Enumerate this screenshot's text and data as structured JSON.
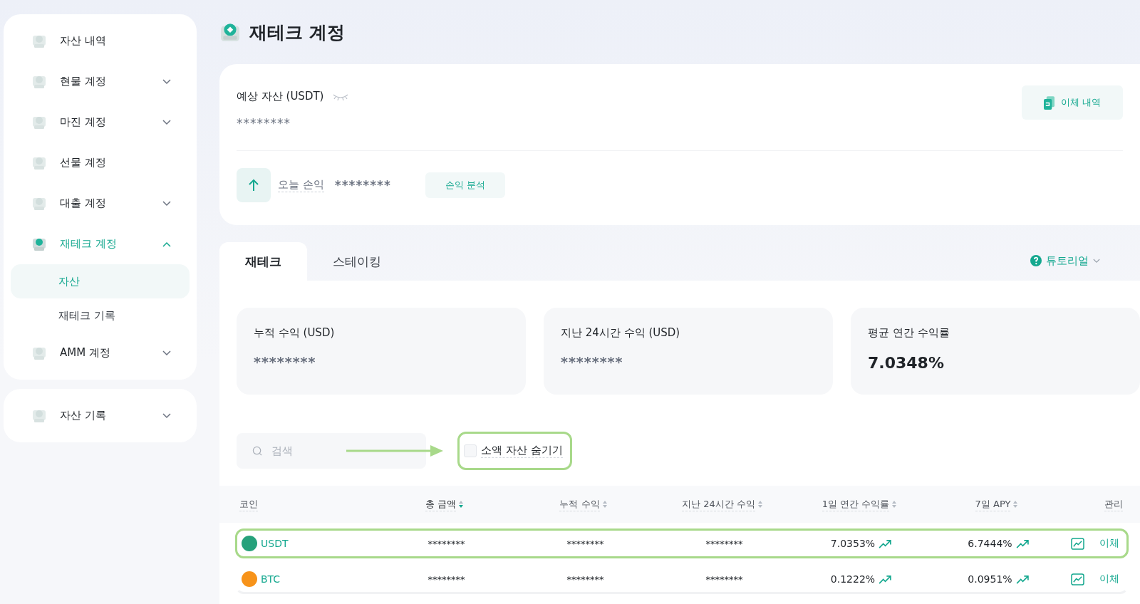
{
  "sidebar": {
    "groups": [
      {
        "items": [
          {
            "label": "자산 내역",
            "kind": "link",
            "selected": false
          },
          {
            "label": "현물 계정",
            "kind": "menu",
            "expanded": false,
            "selected": false
          },
          {
            "label": "마진 계정",
            "kind": "menu",
            "expanded": false,
            "selected": false
          },
          {
            "label": "선물 계정",
            "kind": "link",
            "selected": false
          },
          {
            "label": "대출 계정",
            "kind": "menu",
            "expanded": false,
            "selected": false
          },
          {
            "label": "재테크 계정",
            "kind": "menu",
            "expanded": true,
            "selected": true,
            "children": [
              {
                "label": "자산",
                "selected": true
              },
              {
                "label": "재테크 기록",
                "selected": false
              }
            ]
          },
          {
            "label": "AMM 계정",
            "kind": "menu",
            "expanded": false,
            "selected": false
          }
        ]
      },
      {
        "items": [
          {
            "label": "자산 기록",
            "kind": "menu",
            "expanded": false,
            "selected": false
          }
        ]
      }
    ]
  },
  "page_title": "재테크 계정",
  "overview": {
    "balance_label": "예상 자산 (USDT)",
    "balance_value": "********",
    "history_button": "이체 내역",
    "today_label": "오늘 손익",
    "today_value": "********",
    "analysis_button": "손익 분석"
  },
  "tabs": [
    {
      "label": "재테크",
      "selected": true
    },
    {
      "label": "스테이킹",
      "selected": false
    }
  ],
  "tutorial": "튜토리얼",
  "stats": [
    {
      "label": "누적 수익 (USD)",
      "value": "********"
    },
    {
      "label": "지난 24시간 수익 (USD)",
      "value": "********"
    },
    {
      "label": "평균 연간 수익률",
      "value": "7.0348%"
    }
  ],
  "search": {
    "placeholder": "검색"
  },
  "hide_small": {
    "label": "소액 자산 숨기기",
    "checked": false,
    "highlighted": true
  },
  "table": {
    "columns": [
      {
        "label": "코인",
        "kind": "plain"
      },
      {
        "label": "총 금액",
        "kind": "sortable",
        "sorted": true
      },
      {
        "label": "누적 수익",
        "kind": "sortable",
        "sorted": false
      },
      {
        "label": "지난 24시간 수익",
        "kind": "sortable",
        "sorted": false
      },
      {
        "label": "1일 연간 수익률",
        "kind": "sortable",
        "sorted": false
      },
      {
        "label": "7일 APY",
        "kind": "sortable",
        "sorted": false
      },
      {
        "label": "관리",
        "kind": "plain"
      }
    ],
    "rows": [
      {
        "coin": "USDT",
        "color": "#26a17b",
        "highlighted": true,
        "total": "********",
        "cumulative": "********",
        "last24": "********",
        "apr_1d": "7.0353%",
        "apy_7d": "6.7444%",
        "action": "이체"
      },
      {
        "coin": "BTC",
        "color": "#f7931a",
        "highlighted": false,
        "total": "********",
        "cumulative": "********",
        "last24": "********",
        "apr_1d": "0.1222%",
        "apy_7d": "0.0951%",
        "action": "이체"
      }
    ]
  }
}
